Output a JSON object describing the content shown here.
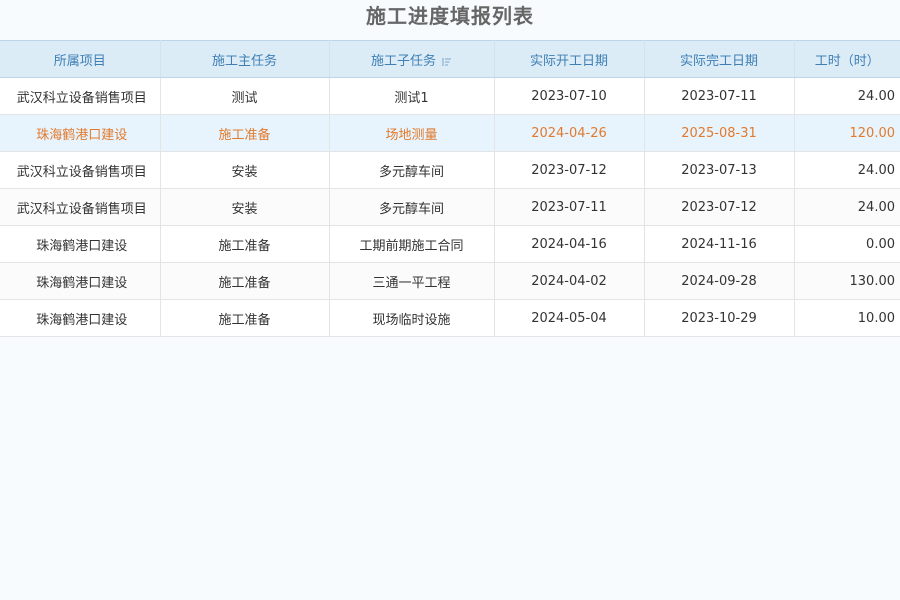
{
  "page": {
    "title": "施工进度填报列表"
  },
  "table": {
    "columns": [
      {
        "label": "所属项目"
      },
      {
        "label": "施工主任务"
      },
      {
        "label": "施工子任务",
        "sort_icon": "sort-icon"
      },
      {
        "label": "实际开工日期"
      },
      {
        "label": "实际完工日期"
      },
      {
        "label": "工时（时）"
      }
    ],
    "rows": [
      {
        "project": "武汉科立设备销售项目",
        "main_task": "测试",
        "sub_task": "测试1",
        "start": "2023-07-10",
        "end": "2023-07-11",
        "hours": "24.00"
      },
      {
        "project": "珠海鹤港口建设",
        "main_task": "施工准备",
        "sub_task": "场地测量",
        "start": "2024-04-26",
        "end": "2025-08-31",
        "hours": "120.00",
        "selected": true
      },
      {
        "project": "武汉科立设备销售项目",
        "main_task": "安装",
        "sub_task": "多元醇车间",
        "start": "2023-07-12",
        "end": "2023-07-13",
        "hours": "24.00"
      },
      {
        "project": "武汉科立设备销售项目",
        "main_task": "安装",
        "sub_task": "多元醇车间",
        "start": "2023-07-11",
        "end": "2023-07-12",
        "hours": "24.00"
      },
      {
        "project": "珠海鹤港口建设",
        "main_task": "施工准备",
        "sub_task": "工期前期施工合同",
        "start": "2024-04-16",
        "end": "2024-11-16",
        "hours": "0.00"
      },
      {
        "project": "珠海鹤港口建设",
        "main_task": "施工准备",
        "sub_task": "三通一平工程",
        "start": "2024-04-02",
        "end": "2024-09-28",
        "hours": "130.00"
      },
      {
        "project": "珠海鹤港口建设",
        "main_task": "施工准备",
        "sub_task": "现场临时设施",
        "start": "2024-05-04",
        "end": "2023-10-29",
        "hours": "10.00"
      }
    ]
  },
  "colors": {
    "header_bg": "#dcecf7",
    "header_text": "#3f7fb5",
    "selected_row_bg": "#e8f4fd",
    "selected_row_text": "#e07a2e"
  }
}
